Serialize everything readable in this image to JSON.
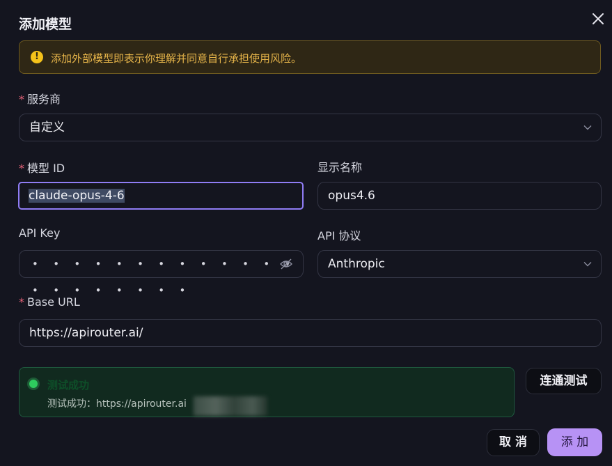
{
  "dialog": {
    "title": "添加模型",
    "warning": "添加外部模型即表示你理解并同意自行承担使用风险。",
    "warning_icon": "!"
  },
  "form": {
    "required_mark": "*",
    "provider": {
      "label": "服务商",
      "value": "自定义"
    },
    "model_id": {
      "label": "模型 ID",
      "value": "claude-opus-4-6"
    },
    "display_name": {
      "label": "显示名称",
      "value": "opus4.6"
    },
    "api_key": {
      "label": "API Key",
      "masked_value": "• • • • • • • • • • • • • • • • • • • • •"
    },
    "api_protocol": {
      "label": "API 协议",
      "value": "Anthropic"
    },
    "base_url": {
      "label": "Base URL",
      "value": "https://apirouter.ai/"
    }
  },
  "test_result": {
    "title": "测试成功",
    "message": "测试成功：https://apirouter.ai",
    "status_color": "#2ecc5e"
  },
  "buttons": {
    "test_connection": "连通测试",
    "cancel": "取 消",
    "add": "添 加"
  },
  "colors": {
    "accent": "#b792f5",
    "focus_border": "#8f7cf4",
    "warning": "#e8b64a",
    "required": "#e8647a"
  },
  "icons": [
    "close-icon",
    "warning-icon",
    "chevron-down-icon",
    "eye-off-icon",
    "status-dot-icon"
  ]
}
